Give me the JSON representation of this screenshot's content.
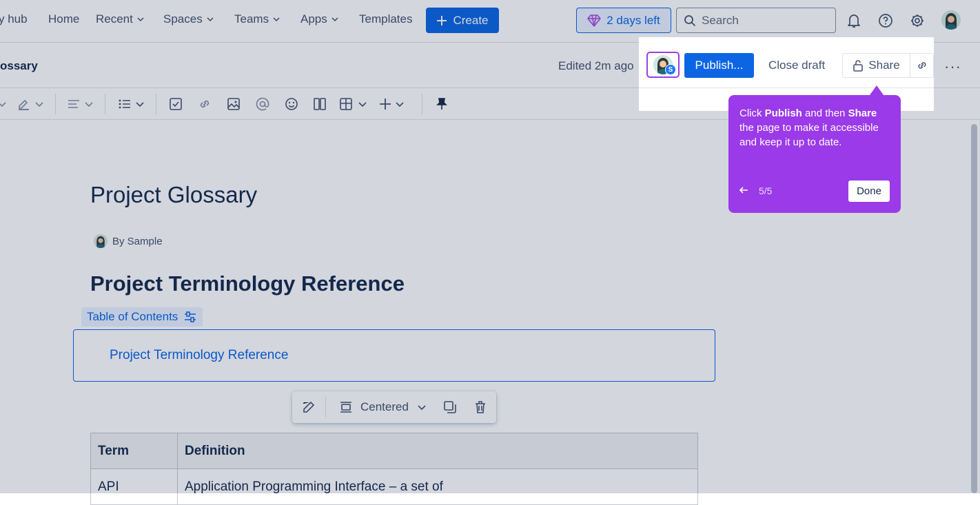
{
  "topnav": {
    "items": [
      {
        "label": "y hub",
        "dropdown": false
      },
      {
        "label": "Home",
        "dropdown": false
      },
      {
        "label": "Recent",
        "dropdown": true
      },
      {
        "label": "Spaces",
        "dropdown": true
      },
      {
        "label": "Teams",
        "dropdown": true
      },
      {
        "label": "Apps",
        "dropdown": true
      },
      {
        "label": "Templates",
        "dropdown": false
      }
    ],
    "create_label": "Create",
    "trial_label": "2 days left",
    "search_placeholder": "Search"
  },
  "page_header": {
    "title": "ossary",
    "edited": "Edited 2m ago",
    "avatar_badge": "S",
    "publish_label": "Publish...",
    "close_draft_label": "Close draft",
    "share_label": "Share",
    "more_label": "···"
  },
  "editor": {
    "title": "Project Glossary",
    "byline": "By Sample",
    "heading": "Project Terminology Reference",
    "toc_tag": "Table of Contents",
    "toc_link": "Project Terminology Reference",
    "float_toolbar_label": "Centered",
    "table": {
      "headers": [
        "Term",
        "Definition"
      ],
      "rows": [
        [
          "API",
          "Application Programming Interface – a set of"
        ]
      ]
    }
  },
  "tour": {
    "text_before": "Click ",
    "bold1": "Publish",
    "text_middle": " and then ",
    "bold2": "Share",
    "text_after": " the page to make it accessible and keep it up to date.",
    "step": "5/5",
    "done_label": "Done"
  },
  "colors": {
    "accent": "#0c66e4",
    "tour": "#9b3ae8",
    "overlay": "rgba(9,30,66,0.18)"
  },
  "icons": [
    "chevron-down-icon",
    "plus-icon",
    "gem-icon",
    "search-icon",
    "bell-icon",
    "help-icon",
    "gear-icon",
    "lock-icon",
    "link-icon",
    "arrow-left-icon",
    "pin-icon",
    "edit-icon",
    "copy-icon",
    "trash-icon"
  ]
}
